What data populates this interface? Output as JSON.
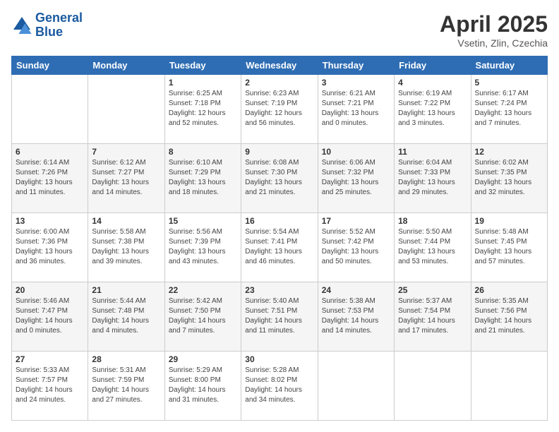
{
  "header": {
    "logo_line1": "General",
    "logo_line2": "Blue",
    "title": "April 2025",
    "subtitle": "Vsetin, Zlin, Czechia"
  },
  "weekdays": [
    "Sunday",
    "Monday",
    "Tuesday",
    "Wednesday",
    "Thursday",
    "Friday",
    "Saturday"
  ],
  "weeks": [
    [
      {
        "day": "",
        "info": ""
      },
      {
        "day": "",
        "info": ""
      },
      {
        "day": "1",
        "info": "Sunrise: 6:25 AM\nSunset: 7:18 PM\nDaylight: 12 hours\nand 52 minutes."
      },
      {
        "day": "2",
        "info": "Sunrise: 6:23 AM\nSunset: 7:19 PM\nDaylight: 12 hours\nand 56 minutes."
      },
      {
        "day": "3",
        "info": "Sunrise: 6:21 AM\nSunset: 7:21 PM\nDaylight: 13 hours\nand 0 minutes."
      },
      {
        "day": "4",
        "info": "Sunrise: 6:19 AM\nSunset: 7:22 PM\nDaylight: 13 hours\nand 3 minutes."
      },
      {
        "day": "5",
        "info": "Sunrise: 6:17 AM\nSunset: 7:24 PM\nDaylight: 13 hours\nand 7 minutes."
      }
    ],
    [
      {
        "day": "6",
        "info": "Sunrise: 6:14 AM\nSunset: 7:26 PM\nDaylight: 13 hours\nand 11 minutes."
      },
      {
        "day": "7",
        "info": "Sunrise: 6:12 AM\nSunset: 7:27 PM\nDaylight: 13 hours\nand 14 minutes."
      },
      {
        "day": "8",
        "info": "Sunrise: 6:10 AM\nSunset: 7:29 PM\nDaylight: 13 hours\nand 18 minutes."
      },
      {
        "day": "9",
        "info": "Sunrise: 6:08 AM\nSunset: 7:30 PM\nDaylight: 13 hours\nand 21 minutes."
      },
      {
        "day": "10",
        "info": "Sunrise: 6:06 AM\nSunset: 7:32 PM\nDaylight: 13 hours\nand 25 minutes."
      },
      {
        "day": "11",
        "info": "Sunrise: 6:04 AM\nSunset: 7:33 PM\nDaylight: 13 hours\nand 29 minutes."
      },
      {
        "day": "12",
        "info": "Sunrise: 6:02 AM\nSunset: 7:35 PM\nDaylight: 13 hours\nand 32 minutes."
      }
    ],
    [
      {
        "day": "13",
        "info": "Sunrise: 6:00 AM\nSunset: 7:36 PM\nDaylight: 13 hours\nand 36 minutes."
      },
      {
        "day": "14",
        "info": "Sunrise: 5:58 AM\nSunset: 7:38 PM\nDaylight: 13 hours\nand 39 minutes."
      },
      {
        "day": "15",
        "info": "Sunrise: 5:56 AM\nSunset: 7:39 PM\nDaylight: 13 hours\nand 43 minutes."
      },
      {
        "day": "16",
        "info": "Sunrise: 5:54 AM\nSunset: 7:41 PM\nDaylight: 13 hours\nand 46 minutes."
      },
      {
        "day": "17",
        "info": "Sunrise: 5:52 AM\nSunset: 7:42 PM\nDaylight: 13 hours\nand 50 minutes."
      },
      {
        "day": "18",
        "info": "Sunrise: 5:50 AM\nSunset: 7:44 PM\nDaylight: 13 hours\nand 53 minutes."
      },
      {
        "day": "19",
        "info": "Sunrise: 5:48 AM\nSunset: 7:45 PM\nDaylight: 13 hours\nand 57 minutes."
      }
    ],
    [
      {
        "day": "20",
        "info": "Sunrise: 5:46 AM\nSunset: 7:47 PM\nDaylight: 14 hours\nand 0 minutes."
      },
      {
        "day": "21",
        "info": "Sunrise: 5:44 AM\nSunset: 7:48 PM\nDaylight: 14 hours\nand 4 minutes."
      },
      {
        "day": "22",
        "info": "Sunrise: 5:42 AM\nSunset: 7:50 PM\nDaylight: 14 hours\nand 7 minutes."
      },
      {
        "day": "23",
        "info": "Sunrise: 5:40 AM\nSunset: 7:51 PM\nDaylight: 14 hours\nand 11 minutes."
      },
      {
        "day": "24",
        "info": "Sunrise: 5:38 AM\nSunset: 7:53 PM\nDaylight: 14 hours\nand 14 minutes."
      },
      {
        "day": "25",
        "info": "Sunrise: 5:37 AM\nSunset: 7:54 PM\nDaylight: 14 hours\nand 17 minutes."
      },
      {
        "day": "26",
        "info": "Sunrise: 5:35 AM\nSunset: 7:56 PM\nDaylight: 14 hours\nand 21 minutes."
      }
    ],
    [
      {
        "day": "27",
        "info": "Sunrise: 5:33 AM\nSunset: 7:57 PM\nDaylight: 14 hours\nand 24 minutes."
      },
      {
        "day": "28",
        "info": "Sunrise: 5:31 AM\nSunset: 7:59 PM\nDaylight: 14 hours\nand 27 minutes."
      },
      {
        "day": "29",
        "info": "Sunrise: 5:29 AM\nSunset: 8:00 PM\nDaylight: 14 hours\nand 31 minutes."
      },
      {
        "day": "30",
        "info": "Sunrise: 5:28 AM\nSunset: 8:02 PM\nDaylight: 14 hours\nand 34 minutes."
      },
      {
        "day": "",
        "info": ""
      },
      {
        "day": "",
        "info": ""
      },
      {
        "day": "",
        "info": ""
      }
    ]
  ]
}
